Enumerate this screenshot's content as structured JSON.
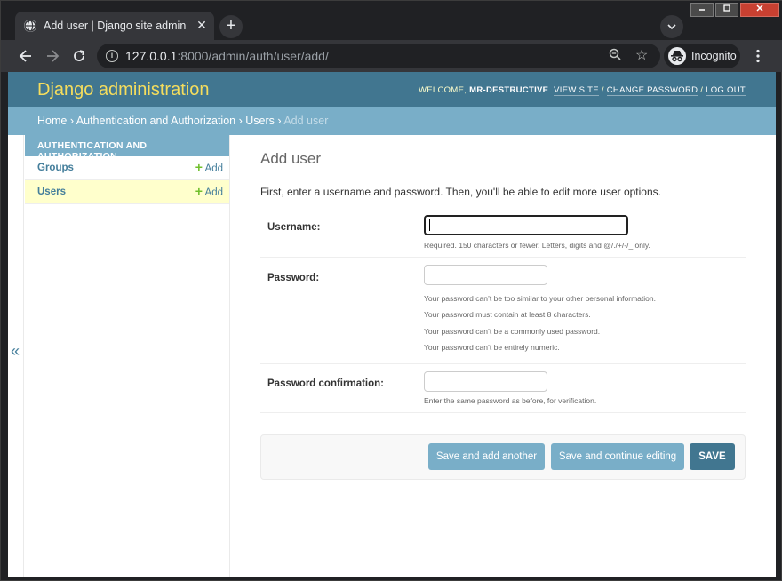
{
  "browser": {
    "tab_title": "Add user | Django site admin",
    "tab_close": "✕",
    "new_tab": "+",
    "url_host": "127.0.0.1",
    "url_rest": ":8000/admin/auth/user/add/",
    "incognito_label": "Incognito",
    "icons": [
      "globe-icon",
      "close-icon",
      "plus-icon",
      "chevron-down-icon",
      "back-arrow-icon",
      "forward-arrow-icon",
      "reload-icon",
      "info-icon",
      "zoom-icon",
      "star-icon",
      "incognito-icon",
      "kebab-menu-icon"
    ]
  },
  "header": {
    "branding": "Django administration",
    "welcome": "Welcome,",
    "username": "mr-destructive",
    "view_site": "View site",
    "change_password": "Change password",
    "log_out": "Log out",
    "sep": "/"
  },
  "breadcrumbs": {
    "home": "Home",
    "app": "Authentication and Authorization",
    "model": "Users",
    "current": "Add user",
    "sep": "›"
  },
  "sidebar": {
    "toggle": "«",
    "app_caption": "Authentication and Authorization",
    "items": [
      {
        "label": "Groups",
        "add": "Add"
      },
      {
        "label": "Users",
        "add": "Add"
      }
    ],
    "plus": "+"
  },
  "form": {
    "title": "Add user",
    "intro": "First, enter a username and password. Then, you'll be able to edit more user options.",
    "username": {
      "label": "Username:",
      "value": "",
      "help": "Required. 150 characters or fewer. Letters, digits and @/./+/-/_ only."
    },
    "password": {
      "label": "Password:",
      "value": "",
      "help": [
        "Your password can’t be too similar to your other personal information.",
        "Your password must contain at least 8 characters.",
        "Your password can’t be a commonly used password.",
        "Your password can’t be entirely numeric."
      ]
    },
    "password_confirmation": {
      "label": "Password confirmation:",
      "value": "",
      "help": "Enter the same password as before, for verification."
    }
  },
  "submit": {
    "save_add_another": "Save and add another",
    "save_continue": "Save and continue editing",
    "save": "SAVE"
  },
  "colors": {
    "header_bg": "#417690",
    "branding": "#f5dd5d",
    "breadcrumb_bg": "#79aec8",
    "current_row_bg": "#ffffcc",
    "add_plus": "#70bf2b"
  }
}
